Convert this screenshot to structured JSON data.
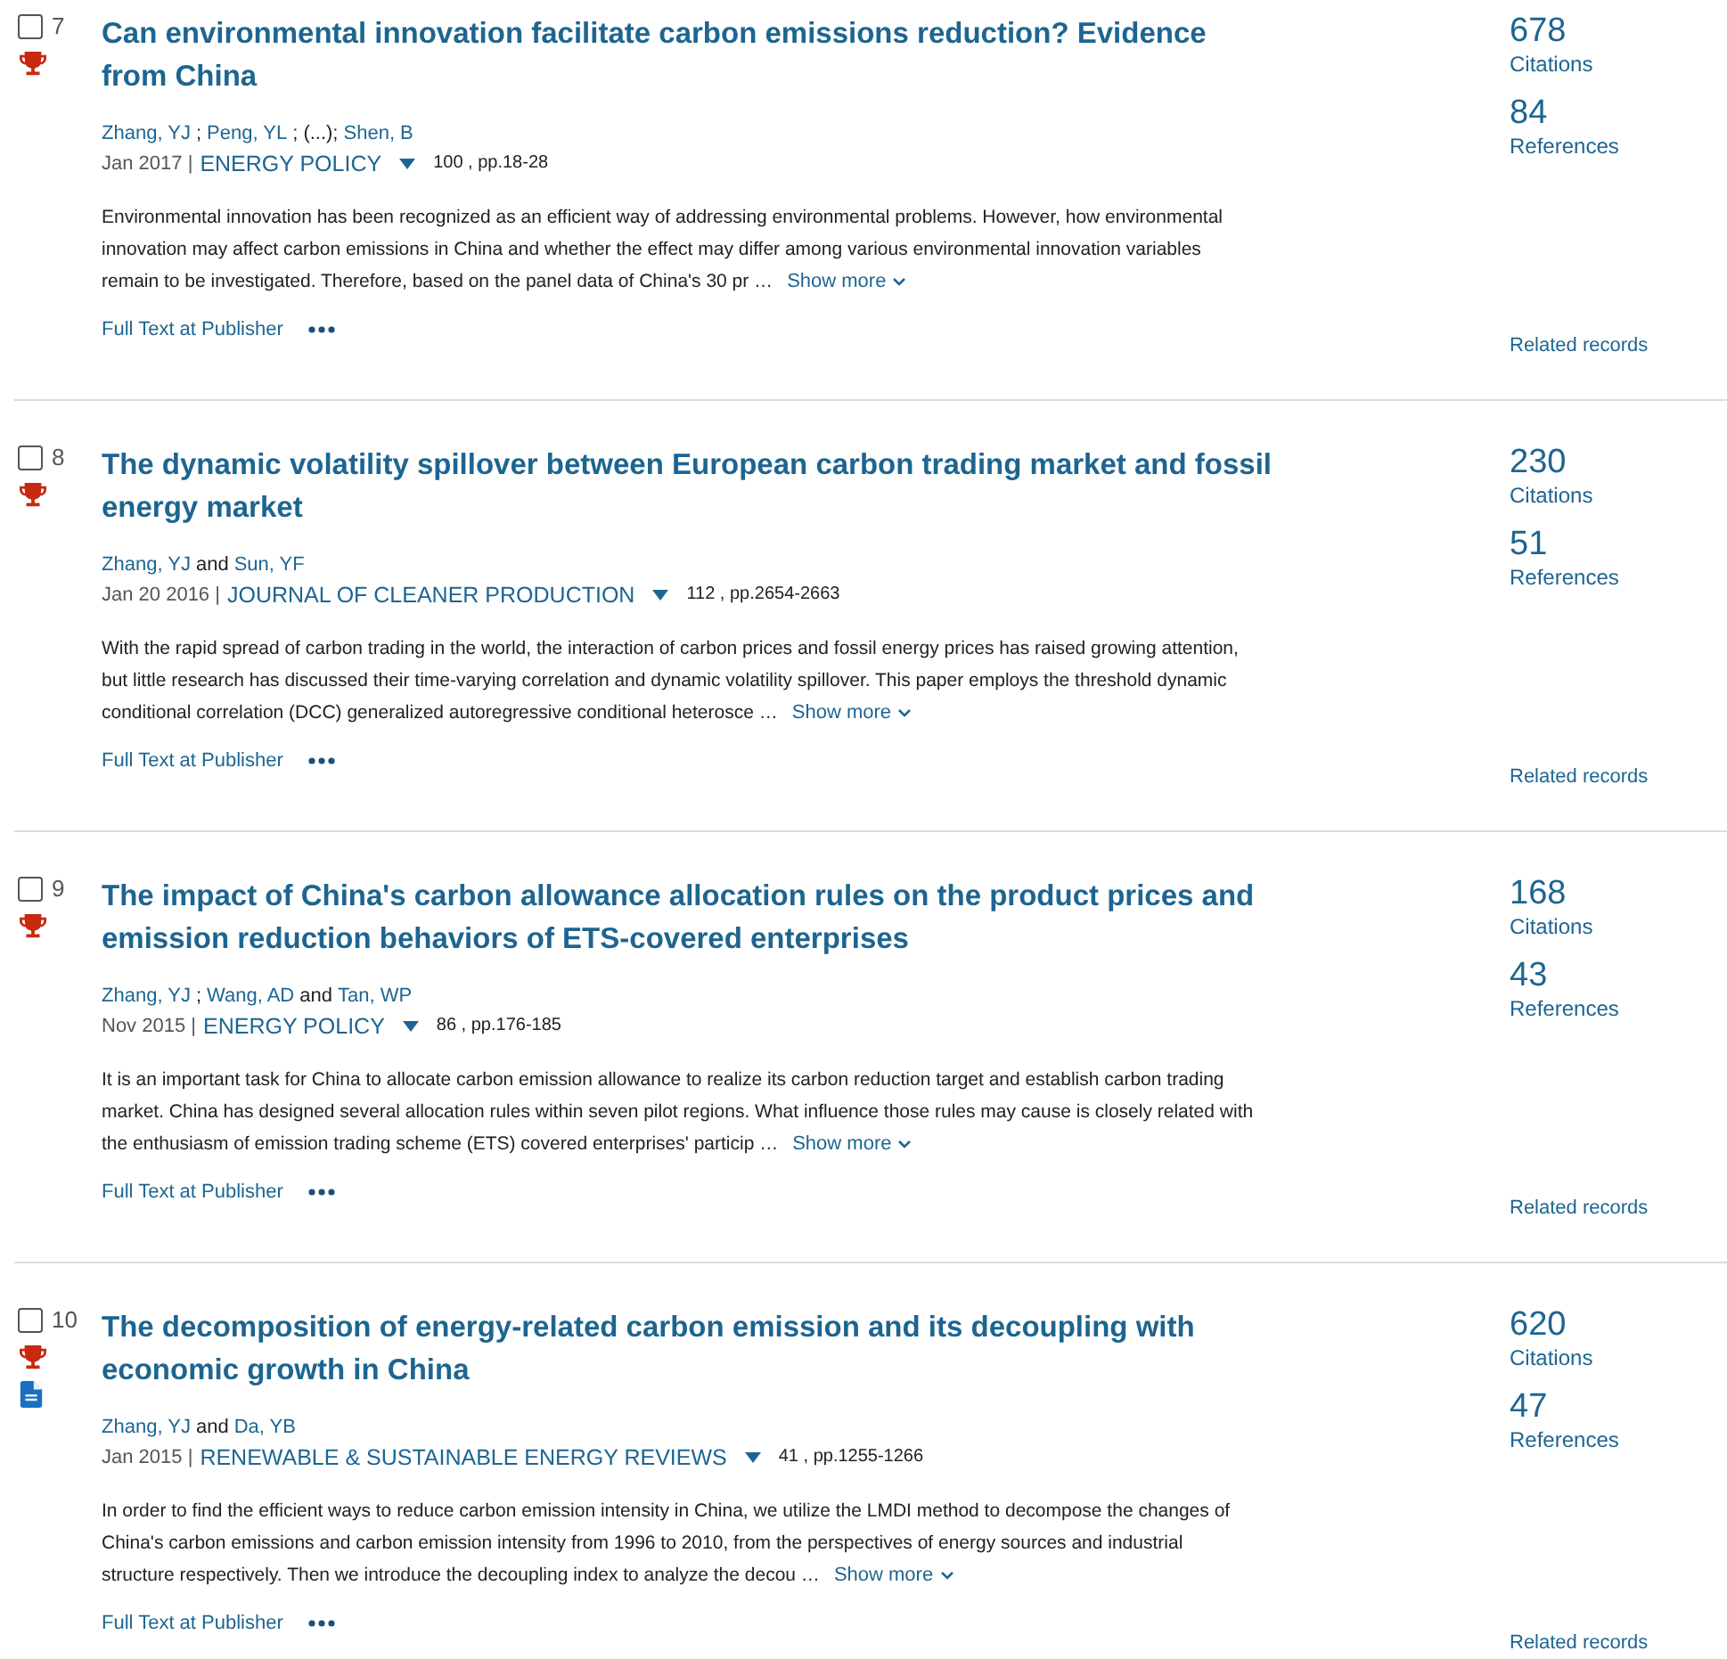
{
  "records": [
    {
      "checked": false,
      "number": "7",
      "highly_cited": true,
      "open_doc": false,
      "title": "Can environmental innovation facilitate carbon emissions reduction? Evidence from China",
      "authors": [
        {
          "kind": "link",
          "text": "Zhang, YJ"
        },
        {
          "kind": "sep",
          "text": ";"
        },
        {
          "kind": "link",
          "text": "Peng, YL"
        },
        {
          "kind": "sep",
          "text": "; (...);"
        },
        {
          "kind": "link",
          "text": "Shen, B"
        }
      ],
      "date": "Jan 2017 |",
      "journal": "ENERGY POLICY",
      "volume": "100 , pp.18-28",
      "abstract": "Environmental innovation has been recognized as an efficient way of addressing environmental problems. However, how environmental innovation may affect carbon emissions in China and whether the effect may differ among various environmental innovation variables remain to be investigated. Therefore, based on the panel data of China's 30 pr …",
      "show_more": "Show more",
      "full_text": "Full Text at Publisher",
      "citations": "678",
      "citations_label": "Citations",
      "references": "84",
      "references_label": "References",
      "related": "Related records"
    },
    {
      "checked": false,
      "number": "8",
      "highly_cited": true,
      "open_doc": false,
      "title": "The dynamic volatility spillover between European carbon trading market and fossil energy market",
      "authors": [
        {
          "kind": "link",
          "text": "Zhang, YJ"
        },
        {
          "kind": "sep",
          "text": "and"
        },
        {
          "kind": "link",
          "text": "Sun, YF"
        }
      ],
      "date": "Jan 20 2016 |",
      "journal": "JOURNAL OF CLEANER PRODUCTION",
      "volume": "112 , pp.2654-2663",
      "abstract": "With the rapid spread of carbon trading in the world, the interaction of carbon prices and fossil energy prices has raised growing attention, but little research has discussed their time-varying correlation and dynamic volatility spillover. This paper employs the threshold dynamic conditional correlation (DCC) generalized autoregressive conditional heterosce …",
      "show_more": "Show more",
      "full_text": "Full Text at Publisher",
      "citations": "230",
      "citations_label": "Citations",
      "references": "51",
      "references_label": "References",
      "related": "Related records"
    },
    {
      "checked": false,
      "number": "9",
      "highly_cited": true,
      "open_doc": false,
      "title": "The impact of China's carbon allowance allocation rules on the product prices and emission reduction behaviors of ETS-covered enterprises",
      "authors": [
        {
          "kind": "link",
          "text": "Zhang, YJ"
        },
        {
          "kind": "sep",
          "text": ";"
        },
        {
          "kind": "link",
          "text": "Wang, AD"
        },
        {
          "kind": "sep",
          "text": "and"
        },
        {
          "kind": "link",
          "text": "Tan, WP"
        }
      ],
      "date": "Nov 2015 |",
      "journal": "ENERGY POLICY",
      "volume": "86 , pp.176-185",
      "abstract": "It is an important task for China to allocate carbon emission allowance to realize its carbon reduction target and establish carbon trading market. China has designed several allocation rules within seven pilot regions. What influence those rules may cause is closely related with the enthusiasm of emission trading scheme (ETS) covered enterprises' particip …",
      "show_more": "Show more",
      "full_text": "Full Text at Publisher",
      "citations": "168",
      "citations_label": "Citations",
      "references": "43",
      "references_label": "References",
      "related": "Related records"
    },
    {
      "checked": false,
      "number": "10",
      "highly_cited": true,
      "open_doc": true,
      "title": "The decomposition of energy-related carbon emission and its decoupling with economic growth in China",
      "authors": [
        {
          "kind": "link",
          "text": "Zhang, YJ"
        },
        {
          "kind": "sep",
          "text": "and"
        },
        {
          "kind": "link",
          "text": "Da, YB"
        }
      ],
      "date": "Jan 2015 |",
      "journal": "RENEWABLE & SUSTAINABLE ENERGY REVIEWS",
      "volume": "41 , pp.1255-1266",
      "abstract": "In order to find the efficient ways to reduce carbon emission intensity in China, we utilize the LMDI method to decompose the changes of China's carbon emissions and carbon emission intensity from 1996 to 2010, from the perspectives of energy sources and industrial structure respectively. Then we introduce the decoupling index to analyze the decou …",
      "show_more": "Show more",
      "full_text": "Full Text at Publisher",
      "citations": "620",
      "citations_label": "Citations",
      "references": "47",
      "references_label": "References",
      "related": "Related records"
    }
  ]
}
